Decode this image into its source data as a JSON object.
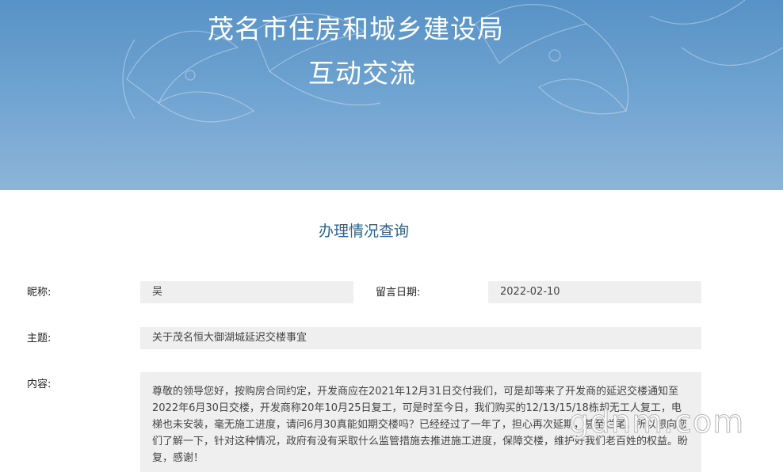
{
  "header": {
    "org_title": "茂名市住房和城乡建设局",
    "page_title": "互动交流"
  },
  "section": {
    "title": "办理情况查询"
  },
  "form": {
    "nickname_label": "昵称:",
    "nickname_value": "吴",
    "date_label": "留言日期:",
    "date_value": "2022-02-10",
    "subject_label": "主题:",
    "subject_value": "关于茂名恒大御湖城延迟交楼事宜",
    "content_label": "内容:",
    "content_value": "尊敬的领导您好，按购房合同约定，开发商应在2021年12月31日交付我们，可是却等来了开发商的延迟交楼通知至2022年6月30日交楼，开发商称20年10月25日复工，可是时至今日，我们购买的12/13/15/18栋却无工人复工，电梯也未安装，毫无施工进度，请问6月30真能如期交楼吗？已经经过了一年了，担心再次延期，甚至烂尾。所以想向您们了解一下，针对这种情况，政府有没有采取什么监管措施去推进施工进度，保障交楼，维护好我们老百姓的权益。盼复，感谢！"
  },
  "watermark": {
    "text": "gdnm.com"
  },
  "colors": {
    "banner_top": "#5792c6",
    "banner_bottom": "#8db5d9",
    "section_title": "#2a6496",
    "field_bg": "#efefef"
  }
}
